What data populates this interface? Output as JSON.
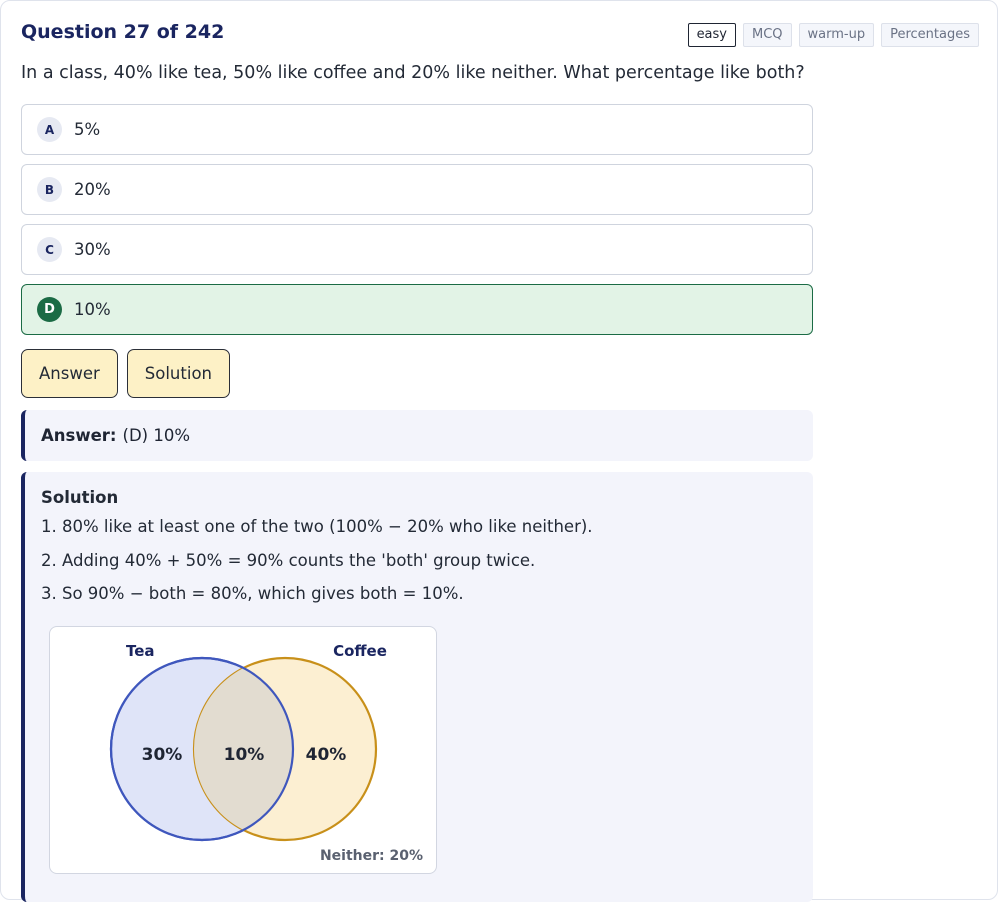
{
  "header": {
    "title": "Question 27 of 242"
  },
  "tags": [
    "easy",
    "MCQ",
    "warm-up",
    "Percentages"
  ],
  "question": "In a class, 40% like tea, 50% like coffee and 20% like neither. What percentage like both?",
  "options": [
    {
      "letter": "A",
      "text": "5%"
    },
    {
      "letter": "B",
      "text": "20%"
    },
    {
      "letter": "C",
      "text": "30%"
    },
    {
      "letter": "D",
      "text": "10%",
      "correct": true
    }
  ],
  "actions": {
    "answer_label": "Answer",
    "solution_label": "Solution"
  },
  "answer": {
    "label": "Answer:",
    "value": "(D) 10%"
  },
  "solution": {
    "heading": "Solution",
    "steps": [
      "1. 80% like at least one of the two (100% − 20% who like neither).",
      "2. Adding 40% + 50% = 90% counts the 'both' group twice.",
      "3. So 90% − both = 80%, which gives both = 10%."
    ]
  },
  "venn": {
    "left_label": "Tea",
    "right_label": "Coffee",
    "left_only": "30%",
    "both": "10%",
    "right_only": "40%",
    "neither": "Neither: 20%",
    "colors": {
      "left_stroke": "#3f57bd",
      "left_fill": "#dfe4f8",
      "right_stroke": "#c8901a",
      "right_fill": "#fcefd2",
      "label": "#1a2560"
    }
  },
  "colors": {
    "accent": "#1a2560",
    "correct_bg": "#e2f3e6",
    "correct_border": "#1b6b45",
    "button_bg": "#fdf1c6"
  }
}
